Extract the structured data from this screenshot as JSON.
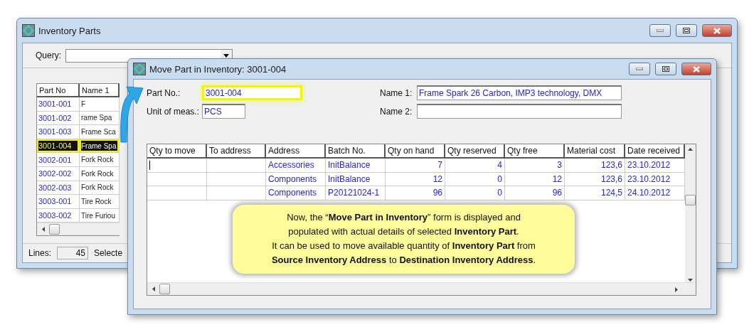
{
  "inventory_parts_window": {
    "title": "Inventory Parts",
    "query_label": "Query:",
    "columns": [
      "Part No",
      "Name 1"
    ],
    "rows": [
      {
        "part_no": "3001-001",
        "name_1": "F",
        "selected": false
      },
      {
        "part_no": "3001-002",
        "name_1": "rame Spa",
        "selected": false
      },
      {
        "part_no": "3001-003",
        "name_1": "Frame Sca",
        "selected": false
      },
      {
        "part_no": "3001-004",
        "name_1": "Frame Spa",
        "selected": true
      },
      {
        "part_no": "3002-001",
        "name_1": "Fork Rock",
        "selected": false
      },
      {
        "part_no": "3002-002",
        "name_1": "Fork Rock",
        "selected": false
      },
      {
        "part_no": "3002-003",
        "name_1": "Fork Rock",
        "selected": false
      },
      {
        "part_no": "3003-001",
        "name_1": "Tire Rock",
        "selected": false
      },
      {
        "part_no": "3003-002",
        "name_1": "Tire Furiou",
        "selected": false
      }
    ],
    "status": {
      "lines_label": "Lines:",
      "lines_value": "45",
      "selected_label": "Selecte"
    }
  },
  "move_part_window": {
    "title": "Move Part in Inventory: 3001-004",
    "fields": [
      {
        "kind": "code",
        "label": "Part No.:",
        "value": "3001-004",
        "highlighted": true
      },
      {
        "kind": "name",
        "label": "Name 1:",
        "value": "Frame Spark 26 Carbon, IMP3 technology, DMX",
        "highlighted": false
      },
      {
        "kind": "unit",
        "label": "Unit of meas.:",
        "value": "PCS",
        "highlighted": false
      },
      {
        "kind": "name",
        "label": "Name 2:",
        "highlighted": false
      }
    ],
    "table": {
      "columns": [
        "Qty to move",
        "To address",
        "Address",
        "Batch No.",
        "Qty on hand",
        "Qty reserved",
        "Qty free",
        "Material cost",
        "Date received"
      ],
      "rows": [
        {
          "editing": true,
          "address": "Accessories",
          "batch_no": "InitBalance",
          "qty_on_hand": "7",
          "qty_reserved": "4",
          "qty_free": "3",
          "material_cost": "123,6",
          "date_received": "23.10.2012"
        },
        {
          "editing": false,
          "address": "Components",
          "batch_no": "InitBalance",
          "qty_on_hand": "12",
          "qty_reserved": "0",
          "qty_free": "12",
          "material_cost": "123,6",
          "date_received": "23.10.2012"
        },
        {
          "editing": false,
          "address": "Components",
          "batch_no": "P20121024-1",
          "qty_on_hand": "96",
          "qty_reserved": "0",
          "qty_free": "96",
          "material_cost": "124,5",
          "date_received": "24.10.2012"
        }
      ]
    }
  },
  "callout": {
    "text": "Now, the “**Move Part in Inventory**” form is displayed and\npopulated with actual details of selected **Inventory Part**.\nIt can be used to move available quantity of **Inventory Part** from\n**Source Inventory Address** to **Destination Inventory Address**."
  }
}
